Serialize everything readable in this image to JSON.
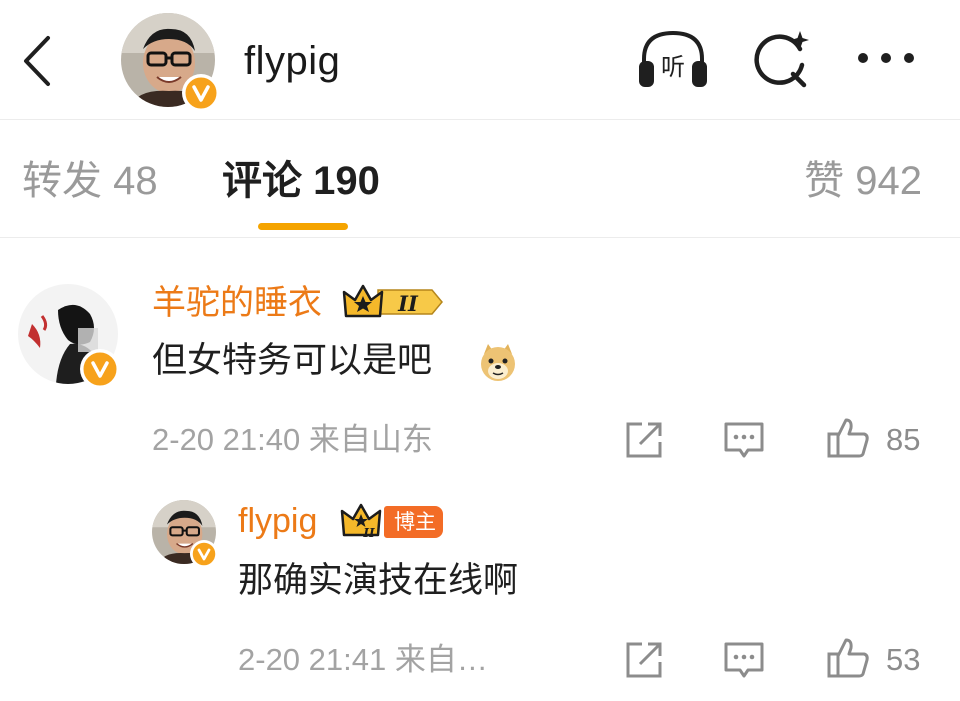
{
  "header": {
    "title": "flypig",
    "listen_label": "听",
    "icons": {
      "back": "chevron-left-icon",
      "listen": "headphones-icon",
      "search": "search-icon",
      "more": "more-dots-icon"
    }
  },
  "tabs": {
    "repost": "转发 48",
    "comments": "评论 190",
    "likes": "赞 942"
  },
  "comments": [
    {
      "user": "羊驼的睡衣",
      "badge_level": "II",
      "text": "但女特务可以是吧",
      "emoji": "doge-emoji",
      "time_location": "2-20 21:40 来自山东",
      "likes": "85",
      "reply": {
        "user": "flypig",
        "badge_level": "II",
        "tag": "博主",
        "text": "那确实演技在线啊",
        "time_location": "2-20 21:41 来自…",
        "likes": "53"
      }
    }
  ],
  "colors": {
    "accent": "#f5a400",
    "username": "#ec7a17",
    "host_tag": "#f36c26",
    "verified_badge": "#f7a21b"
  }
}
